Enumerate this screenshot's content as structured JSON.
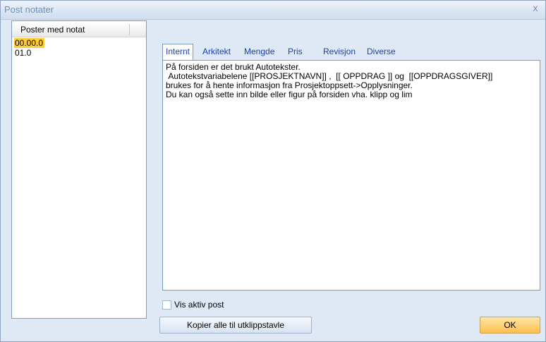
{
  "window": {
    "title": "Post notater",
    "close_glyph": "x"
  },
  "poster_list": {
    "header": "Poster med notat",
    "items": [
      {
        "label": "00.00.0",
        "selected": true
      },
      {
        "label": "01.0",
        "selected": false
      }
    ]
  },
  "tabs": [
    {
      "label": "Internt",
      "active": true
    },
    {
      "label": "Arkitekt",
      "active": false
    },
    {
      "label": "Mengde",
      "active": false
    },
    {
      "label": "Pris",
      "active": false
    },
    {
      "label": "Revisjon",
      "active": false
    },
    {
      "label": "Diverse",
      "active": false
    }
  ],
  "note": {
    "text": "På forsiden er det brukt Autotekster.\n Autotekstvariabelene [[PROSJEKTNAVN]] ,  [[ OPPDRAG ]] og  [[OPPDRAGSGIVER]]\nbrukes for å hente informasjon fra Prosjektoppsett->Opplysninger.\nDu kan også sette inn bilde eller figur på forsiden vha. klipp og lim"
  },
  "options": {
    "vis_aktiv_post_label": "Vis aktiv post",
    "vis_aktiv_post_checked": false
  },
  "buttons": {
    "copy_label": "Kopier alle til utklippstavle",
    "ok_label": "OK"
  },
  "colors": {
    "selection": "#ffcc33",
    "tab_text": "#1a3fa8",
    "dialog_bg": "#dfe9f5",
    "ok_button": "#ffd37a"
  }
}
